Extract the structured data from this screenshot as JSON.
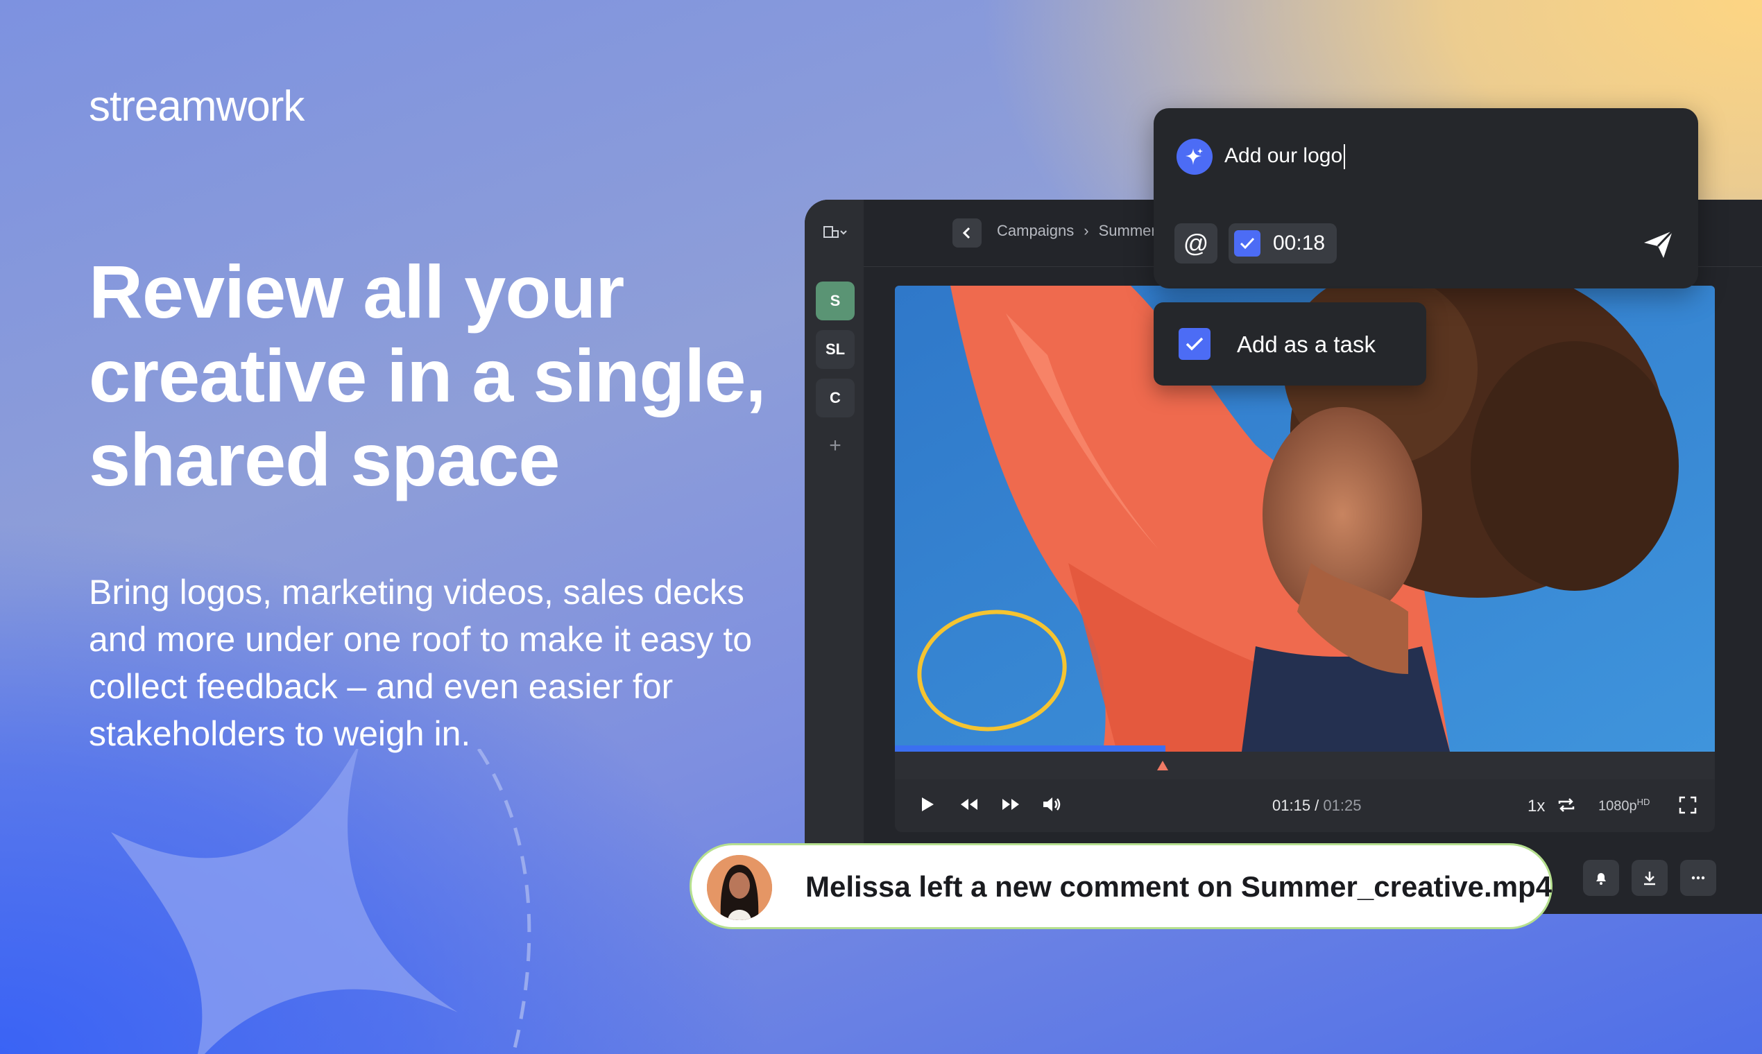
{
  "brand": {
    "logo_text": "streamwork"
  },
  "hero": {
    "headline": "Review all your creative in a single, shared space",
    "body": "Bring logos, marketing videos, sales decks and more under one roof to make it easy to collect feedback – and even easier for stakeholders to weigh in."
  },
  "sidebar": {
    "items": [
      {
        "label": "S",
        "color": "#5a9474"
      },
      {
        "label": "SL"
      },
      {
        "label": "C"
      }
    ],
    "add_label": "+"
  },
  "breadcrumb": {
    "items": [
      "Campaigns",
      "Summer launch"
    ]
  },
  "composer": {
    "input_value": "Add our logo",
    "mention_symbol": "@",
    "timestamp": "00:18",
    "accent": "#4c6cf5"
  },
  "task_popup": {
    "label": "Add as a task"
  },
  "player": {
    "current_time": "01:15",
    "separator": " / ",
    "total_time": "01:25",
    "speed": "1x",
    "quality": "1080p",
    "quality_badge": "HD",
    "progress_fraction": 0.33
  },
  "toast": {
    "text": "Melissa left a new comment on Summer_creative.mp4",
    "border_color": "#b6e08f"
  },
  "colors": {
    "app_bg": "#23252a",
    "accent_blue": "#4c6cf5",
    "marker": "#f07a65",
    "annotation": "#f5c431"
  }
}
